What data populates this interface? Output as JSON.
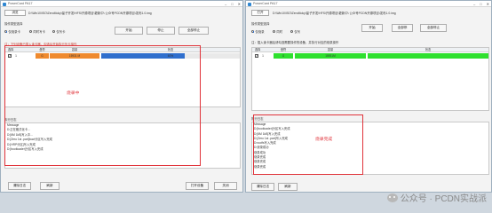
{
  "left": {
    "title": "PowerCard PA17",
    "browse_label": "浏览",
    "path": "D:\\Win10\\ISO\\ZeroMoky\\量子开发\\HFS\\开源项目\\更新中\\ 公众号PCDN开源项目\\发布1.0.img",
    "mode_label": "操作类型选择",
    "radios": [
      "仅烧录卡",
      "同时写卡",
      "仅写卡"
    ],
    "radio_selected": 0,
    "buttons": [
      "开始",
      "停止",
      "全部停止"
    ],
    "table_caption": "注：下列设备已插入读卡器，勾选后开始执行写卡操作",
    "columns": [
      "选择",
      "盘符",
      "容量",
      "状态"
    ],
    "rows": [
      {
        "checked": true,
        "index": "1",
        "drive": "G",
        "capacity": "15931 M",
        "progress_pct": 60,
        "status": "60%"
      }
    ],
    "log_label": "执行日志",
    "log_lines": [
      "Message",
      "D:正在格式化卡...",
      "D:[6M 1kB]写入中...",
      "D:[Zero 1st .part]boot分区写入完成",
      "D:[HRP分区]写入完成",
      "D:[bootloader]分区写入完成"
    ],
    "bottom_buttons": [
      "清除日志",
      "刷新",
      "打开设备",
      "关闭"
    ],
    "annotation": "烧录中"
  },
  "right": {
    "title": "PowerCard PA17",
    "browse_label": "打开",
    "path": "D:\\Win10\\ISO\\ZeroMoky\\量子开发\\HFS\\开源项目\\更新中\\ 公众号PCDN开源项目\\发布1.0.img",
    "mode_label": "操作类型选择",
    "radios": [
      "仅烧录",
      "同时",
      "仅写"
    ],
    "radio_selected": 0,
    "buttons": [
      "开始",
      "全部停",
      "全部停止"
    ],
    "table_caption": "注：插入读卡器后请勾选需要操作的设备，并执行对应的烧录操作",
    "columns": [
      "选择",
      "盘符",
      "容量",
      "状态"
    ],
    "rows": [
      {
        "checked": true,
        "index": "1",
        "drive": "G",
        "capacity": "15931M",
        "progress_pct": 100,
        "status": ""
      }
    ],
    "log_label": "执行日志",
    "log_lines": [
      "Message",
      "D:[bootloader]分区写入完成",
      "D:[6M 1kB]写入完成",
      "D:[Zero 1st .part]写入完成",
      "D:rootfs写入完成",
      "D:烧录成功",
      "烧录成功",
      "烧录完成",
      "烧录完成",
      "烧录完成"
    ],
    "bottom_buttons": [
      "清除日志",
      "刷新"
    ],
    "annotation": "烧录完成"
  },
  "watermark": "公众号 · PCDN实战派",
  "colors": {
    "progress_orange": "#ef8a2e",
    "progress_blue": "#2f6fcd",
    "progress_green": "#2ee02e",
    "annotation_red": "#e0333a"
  }
}
